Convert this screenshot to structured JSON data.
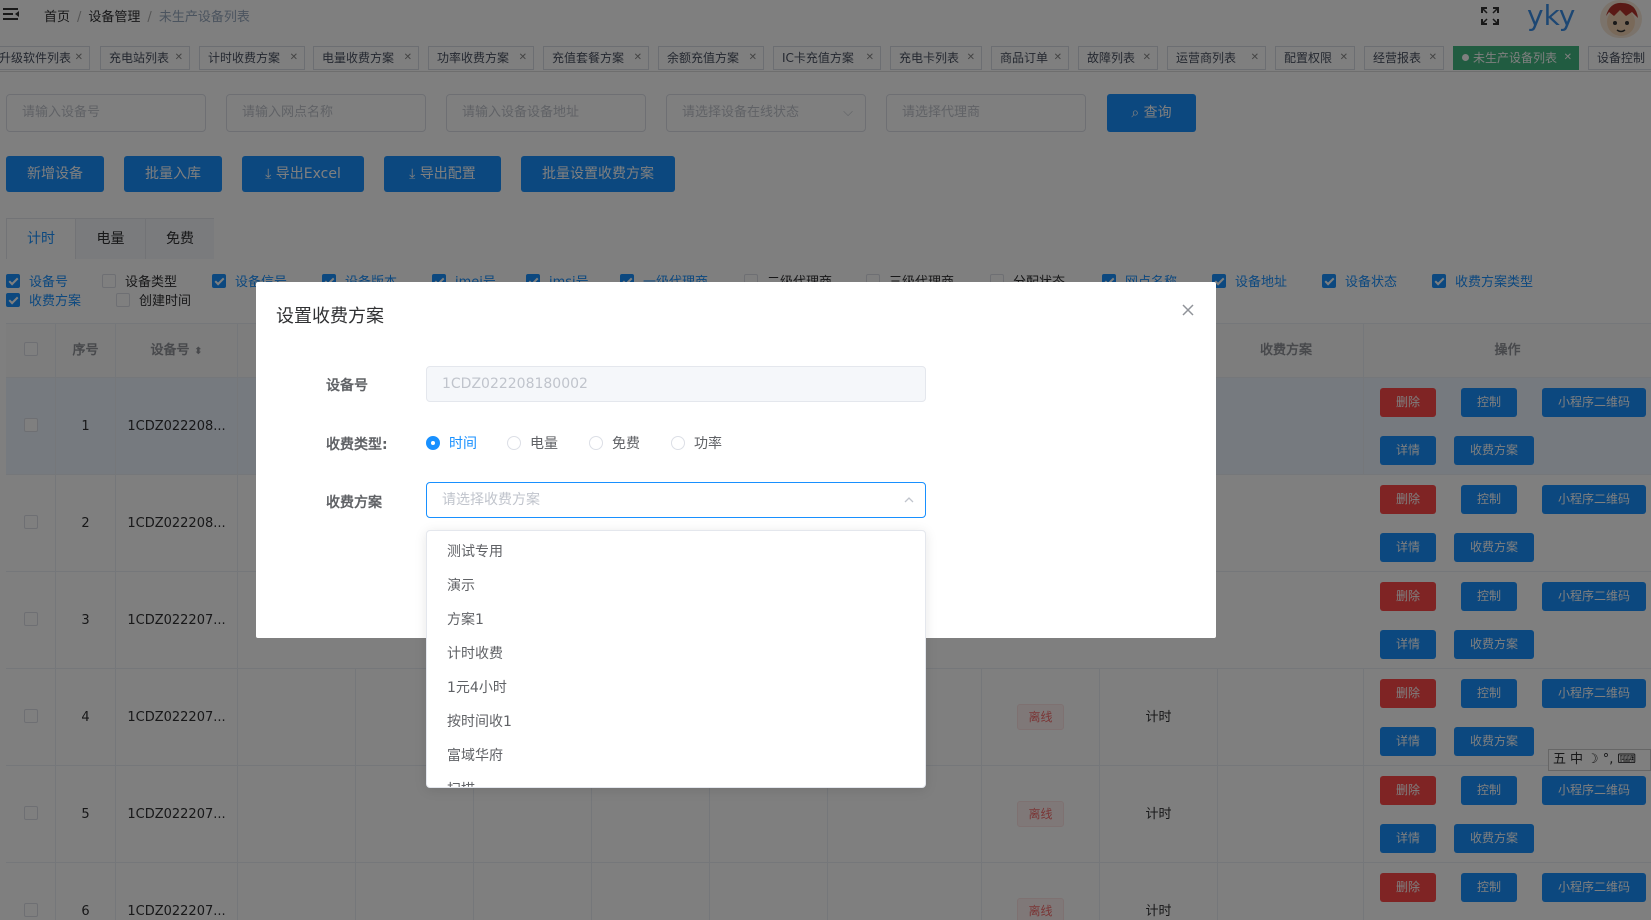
{
  "breadcrumb": {
    "home": "首页",
    "sep": "/",
    "section": "设备管理",
    "current": "未生产设备列表"
  },
  "user": {
    "name": "yky"
  },
  "tags": [
    {
      "label": "升级软件列表",
      "active": false
    },
    {
      "label": "充电站列表",
      "active": false
    },
    {
      "label": "计时收费方案",
      "active": false
    },
    {
      "label": "电量收费方案",
      "active": false
    },
    {
      "label": "功率收费方案",
      "active": false
    },
    {
      "label": "充值套餐方案",
      "active": false
    },
    {
      "label": "余额充值方案",
      "active": false
    },
    {
      "label": "IC卡充值方案",
      "active": false
    },
    {
      "label": "充电卡列表",
      "active": false
    },
    {
      "label": "商品订单",
      "active": false
    },
    {
      "label": "故障列表",
      "active": false
    },
    {
      "label": "运营商列表",
      "active": false
    },
    {
      "label": "配置权限",
      "active": false
    },
    {
      "label": "经营报表",
      "active": false
    },
    {
      "label": "未生产设备列表",
      "active": true
    },
    {
      "label": "设备控制",
      "active": false
    }
  ],
  "filters": {
    "device_no_placeholder": "请输入设备号",
    "site_placeholder": "请输入网点名称",
    "address_placeholder": "请输入设备设备地址",
    "status_placeholder": "请选择设备在线状态",
    "agent_placeholder": "请选择代理商",
    "query_label": "查询"
  },
  "toolbar": {
    "add_label": "新增设备",
    "batch_in_label": "批量入库",
    "export_excel_label": "导出Excel",
    "export_config_label": "导出配置",
    "batch_plan_label": "批量设置收费方案"
  },
  "tabs": [
    {
      "label": "计时",
      "active": true
    },
    {
      "label": "电量",
      "active": false
    },
    {
      "label": "免费",
      "active": false
    }
  ],
  "columns_row1": [
    {
      "label": "设备号",
      "checked": true
    },
    {
      "label": "设备类型",
      "checked": false
    },
    {
      "label": "设备信号",
      "checked": true
    },
    {
      "label": "设备版本",
      "checked": true
    },
    {
      "label": "imei号",
      "checked": true
    },
    {
      "label": "imsi号",
      "checked": true
    },
    {
      "label": "一级代理商",
      "checked": true
    },
    {
      "label": "二级代理商",
      "checked": false
    },
    {
      "label": "三级代理商",
      "checked": false
    },
    {
      "label": "分配状态",
      "checked": false
    },
    {
      "label": "网点名称",
      "checked": true
    },
    {
      "label": "设备地址",
      "checked": true
    },
    {
      "label": "设备状态",
      "checked": true
    },
    {
      "label": "收费方案类型",
      "checked": true
    }
  ],
  "columns_row2": [
    {
      "label": "收费方案",
      "checked": true
    },
    {
      "label": "创建时间",
      "checked": false
    }
  ],
  "table": {
    "headers": {
      "index": "序号",
      "device_no": "设备号",
      "plan": "收费方案",
      "ops": "操作",
      "sort_icon": "sort-icon"
    },
    "rows": [
      {
        "index": "1",
        "device_no": "1CDZ022208...",
        "status": "",
        "plan_type": ""
      },
      {
        "index": "2",
        "device_no": "1CDZ022208...",
        "status": "",
        "plan_type": ""
      },
      {
        "index": "3",
        "device_no": "1CDZ022207...",
        "status": "",
        "plan_type": ""
      },
      {
        "index": "4",
        "device_no": "1CDZ022207...",
        "status": "离线",
        "plan_type": "计时"
      },
      {
        "index": "5",
        "device_no": "1CDZ022207...",
        "status": "离线",
        "plan_type": "计时"
      },
      {
        "index": "6",
        "device_no": "1CDZ022207...",
        "status": "离线",
        "plan_type": "计时"
      }
    ],
    "actions": {
      "delete": "删除",
      "control": "控制",
      "qrcode": "小程序二维码",
      "detail": "详情",
      "plan": "收费方案"
    }
  },
  "dialog": {
    "title": "设置收费方案",
    "device_no_label": "设备号",
    "device_no_value": "1CDZ022208180002",
    "charge_type_label": "收费类型:",
    "charge_types": [
      {
        "label": "时间",
        "selected": true
      },
      {
        "label": "电量",
        "selected": false
      },
      {
        "label": "免费",
        "selected": false
      },
      {
        "label": "功率",
        "selected": false
      }
    ],
    "plan_label": "收费方案",
    "plan_placeholder": "请选择收费方案",
    "options": [
      "测试专用",
      "演示",
      "方案1",
      "计时收费",
      "1元4小时",
      "按时间收1",
      "富域华府",
      "扫描"
    ]
  },
  "ime": {
    "items": [
      "五",
      "中",
      "☽",
      "°,",
      "⌨"
    ]
  },
  "colors": {
    "primary": "#1890ff",
    "danger": "#ff4949",
    "active_tag": "#42b983"
  }
}
